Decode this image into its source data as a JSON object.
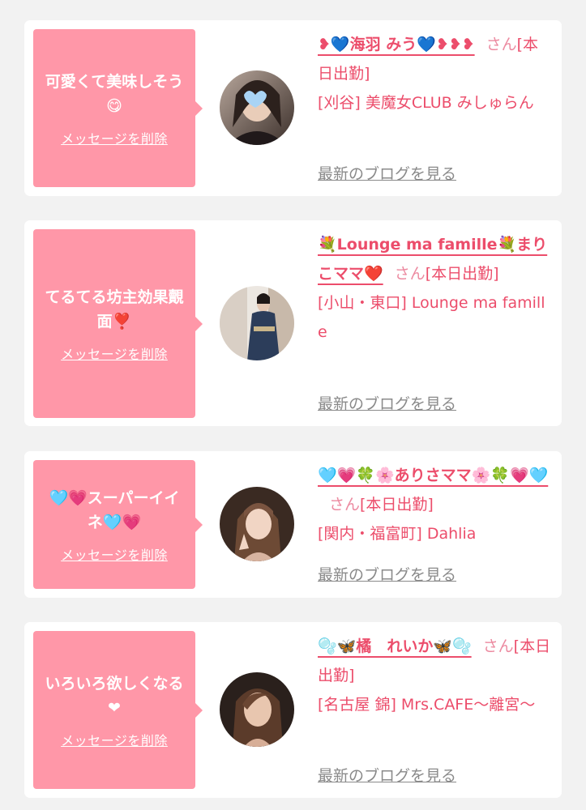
{
  "cards": [
    {
      "message": "可愛くて美味しそう😋",
      "delete_label": "メッセージを削除",
      "name": "❥💙海羽 みう💙❥❥❥",
      "honorific": "さん",
      "status": "[本日出勤]",
      "shop": "[刈谷] 美魔女CLUB みしゅらん",
      "blog_label": "最新のブログを見る",
      "avatar_icon": "profile-photo-icon"
    },
    {
      "message": "てるてる坊主効果覿面❣️",
      "delete_label": "メッセージを削除",
      "name": "💐Lounge ma famille💐まりこママ❤️",
      "honorific": "さん",
      "status": "[本日出勤]",
      "shop": "[小山・東口] Lounge ma famille",
      "blog_label": "最新のブログを見る",
      "avatar_icon": "profile-photo-icon"
    },
    {
      "message": "🩵💗スーパーイイネ🩵💗",
      "delete_label": "メッセージを削除",
      "name": "🩵💗🍀🌸ありさママ🌸🍀💗🩵",
      "honorific": "さん",
      "status": "[本日出勤]",
      "shop": "[関内・福富町] Dahlia",
      "blog_label": "最新のブログを見る",
      "avatar_icon": "profile-photo-icon"
    },
    {
      "message": "いろいろ欲しくなる❤",
      "delete_label": "メッセージを削除",
      "name": "🫧🦋橘　れいか🦋🫧",
      "honorific": "さん",
      "status": "[本日出勤]",
      "shop": "[名古屋 錦] Mrs.CAFE～離宮～",
      "blog_label": "最新のブログを見る",
      "avatar_icon": "profile-photo-icon"
    }
  ],
  "colors": {
    "bubble": "#ff97a8",
    "accent": "#ec4d6b",
    "honorific": "#ec8aa0",
    "link_gray": "#8a8a8a",
    "background": "#f2f2f2"
  }
}
